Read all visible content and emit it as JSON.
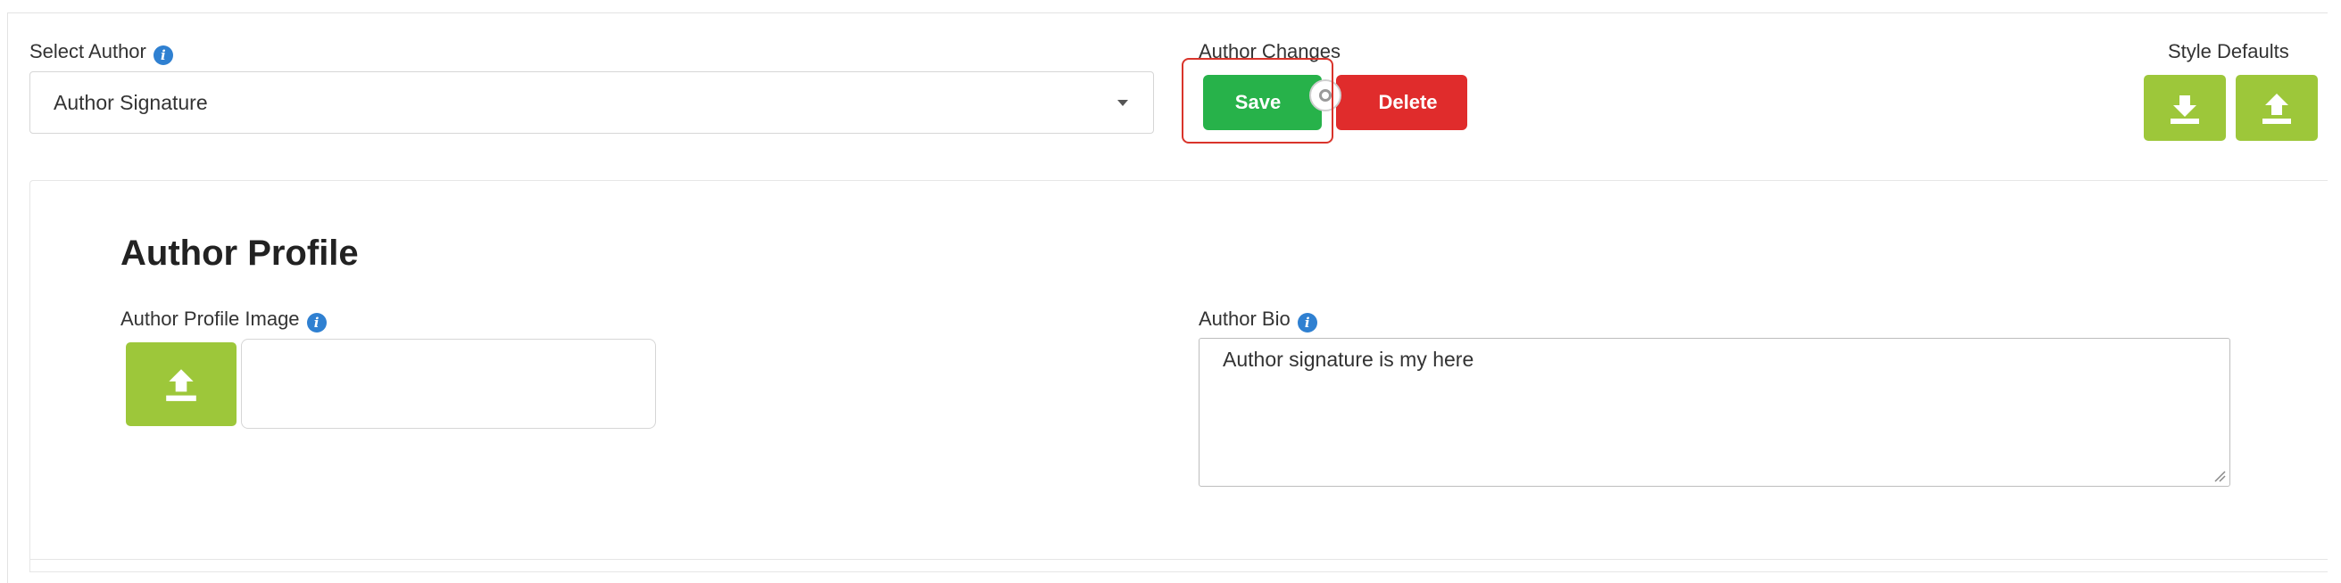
{
  "author_select": {
    "label": "Select Author",
    "selected": "Author Signature"
  },
  "author_changes": {
    "label": "Author Changes",
    "save_label": "Save",
    "delete_label": "Delete"
  },
  "style_defaults": {
    "label": "Style Defaults",
    "icons": [
      "download-icon",
      "upload-icon"
    ]
  },
  "profile": {
    "title": "Author Profile",
    "image_label": "Author Profile Image",
    "image_upload_icon": "upload-icon",
    "bio_label": "Author Bio",
    "bio_value": "Author signature is my here"
  },
  "colors": {
    "save": "#27b24a",
    "delete": "#e02c2c",
    "lime": "#9dc73a",
    "info": "#2f80d1",
    "highlight": "#d9342b"
  }
}
